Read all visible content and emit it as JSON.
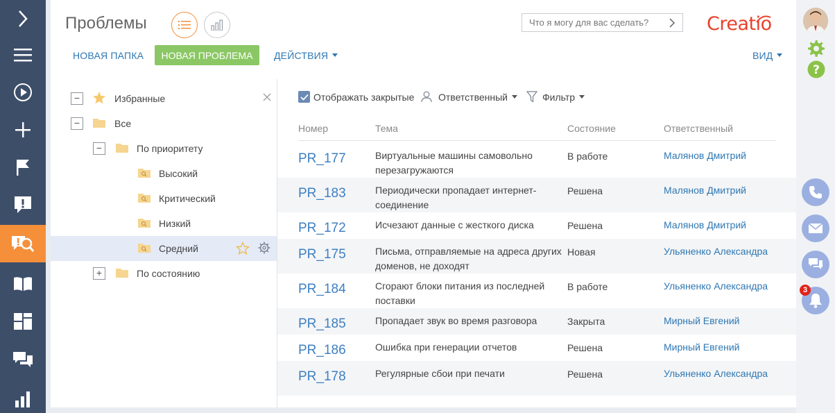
{
  "header": {
    "title": "Проблемы",
    "search_placeholder": "Что я могу для вас сделать?",
    "logo_text": "Creatio"
  },
  "toolbar": {
    "new_folder": "НОВАЯ ПАПКА",
    "new_problem": "НОВАЯ ПРОБЛЕМА",
    "actions": "ДЕЙСТВИЯ",
    "view": "ВИД"
  },
  "tree": {
    "favorites": "Избранные",
    "all": "Все",
    "by_priority": "По приоритету",
    "high": "Высокий",
    "critical": "Критический",
    "low": "Низкий",
    "medium": "Средний",
    "by_state": "По состоянию"
  },
  "filters": {
    "show_closed": "Отображать закрытые",
    "owner": "Ответственный",
    "filter": "Фильтр"
  },
  "grid": {
    "columns": [
      "Номер",
      "Тема",
      "Состояние",
      "Ответственный"
    ],
    "rows": [
      {
        "number": "PR_177",
        "subject": "Виртуальные машины самовольно перезагружаются",
        "state": "В работе",
        "owner": "Малянов Дмитрий"
      },
      {
        "number": "PR_183",
        "subject": "Периодически пропадает интернет-соединение",
        "state": "Решена",
        "owner": "Малянов Дмитрий"
      },
      {
        "number": "PR_172",
        "subject": "Исчезают данные с жесткого диска",
        "state": "Решена",
        "owner": "Малянов Дмитрий"
      },
      {
        "number": "PR_175",
        "subject": "Письма, отправляемые на адреса других доменов, не доходят",
        "state": "Новая",
        "owner": "Ульяненко Александра"
      },
      {
        "number": "PR_184",
        "subject": "Сгорают блоки питания из последней поставки",
        "state": "В работе",
        "owner": "Ульяненко Александра"
      },
      {
        "number": "PR_185",
        "subject": "Пропадает звук во время разговора",
        "state": "Закрыта",
        "owner": "Мирный Евгений"
      },
      {
        "number": "PR_186",
        "subject": "Ошибка при генерации отчетов",
        "state": "Решена",
        "owner": "Мирный Евгений"
      },
      {
        "number": "PR_178",
        "subject": "Регулярные сбои при печати",
        "state": "Решена",
        "owner": "Ульяненко Александра"
      }
    ]
  },
  "side": {
    "notification_count": "3"
  },
  "colors": {
    "nav_bg": "#3d4e69",
    "accent_orange": "#f58f3a",
    "new_button_green": "#8bc764",
    "link_blue": "#2e77b3",
    "side_button_blue": "#9bb0e0",
    "badge_red": "#e2231a"
  }
}
